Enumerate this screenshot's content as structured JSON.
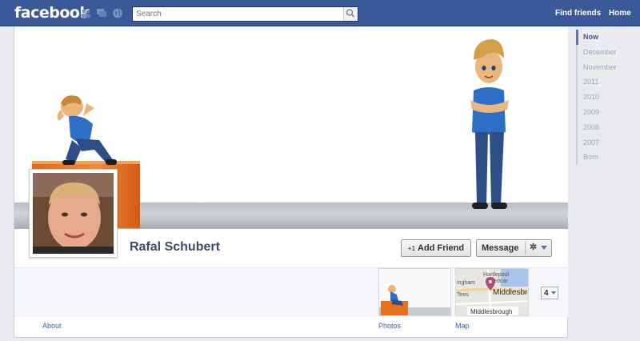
{
  "topbar": {
    "logo": "facebook",
    "search_placeholder": "Search",
    "nav": [
      "Find friends",
      "Home"
    ],
    "bg_color": "#3b5998"
  },
  "profile": {
    "name": "Rafal Schubert",
    "add_friend_label": "Add Friend",
    "add_friend_prefix": "+1",
    "message_label": "Message",
    "more_count": "4"
  },
  "tabs": {
    "about": "About",
    "photos": "Photos",
    "map": "Map"
  },
  "map": {
    "labels": [
      "Hartlepool",
      "Redcar",
      "Middlesbrou",
      "Middlesbrough",
      "ingham",
      "Tees"
    ]
  },
  "timeline": {
    "items": [
      "Now",
      "December",
      "November",
      "2011",
      "2010",
      "2009",
      "2008",
      "2007",
      "Born"
    ]
  },
  "icons": {
    "friends": "friends-icon",
    "messages": "messages-icon",
    "globe": "globe-icon",
    "search": "magnifier-icon",
    "gear": "gear-icon"
  }
}
